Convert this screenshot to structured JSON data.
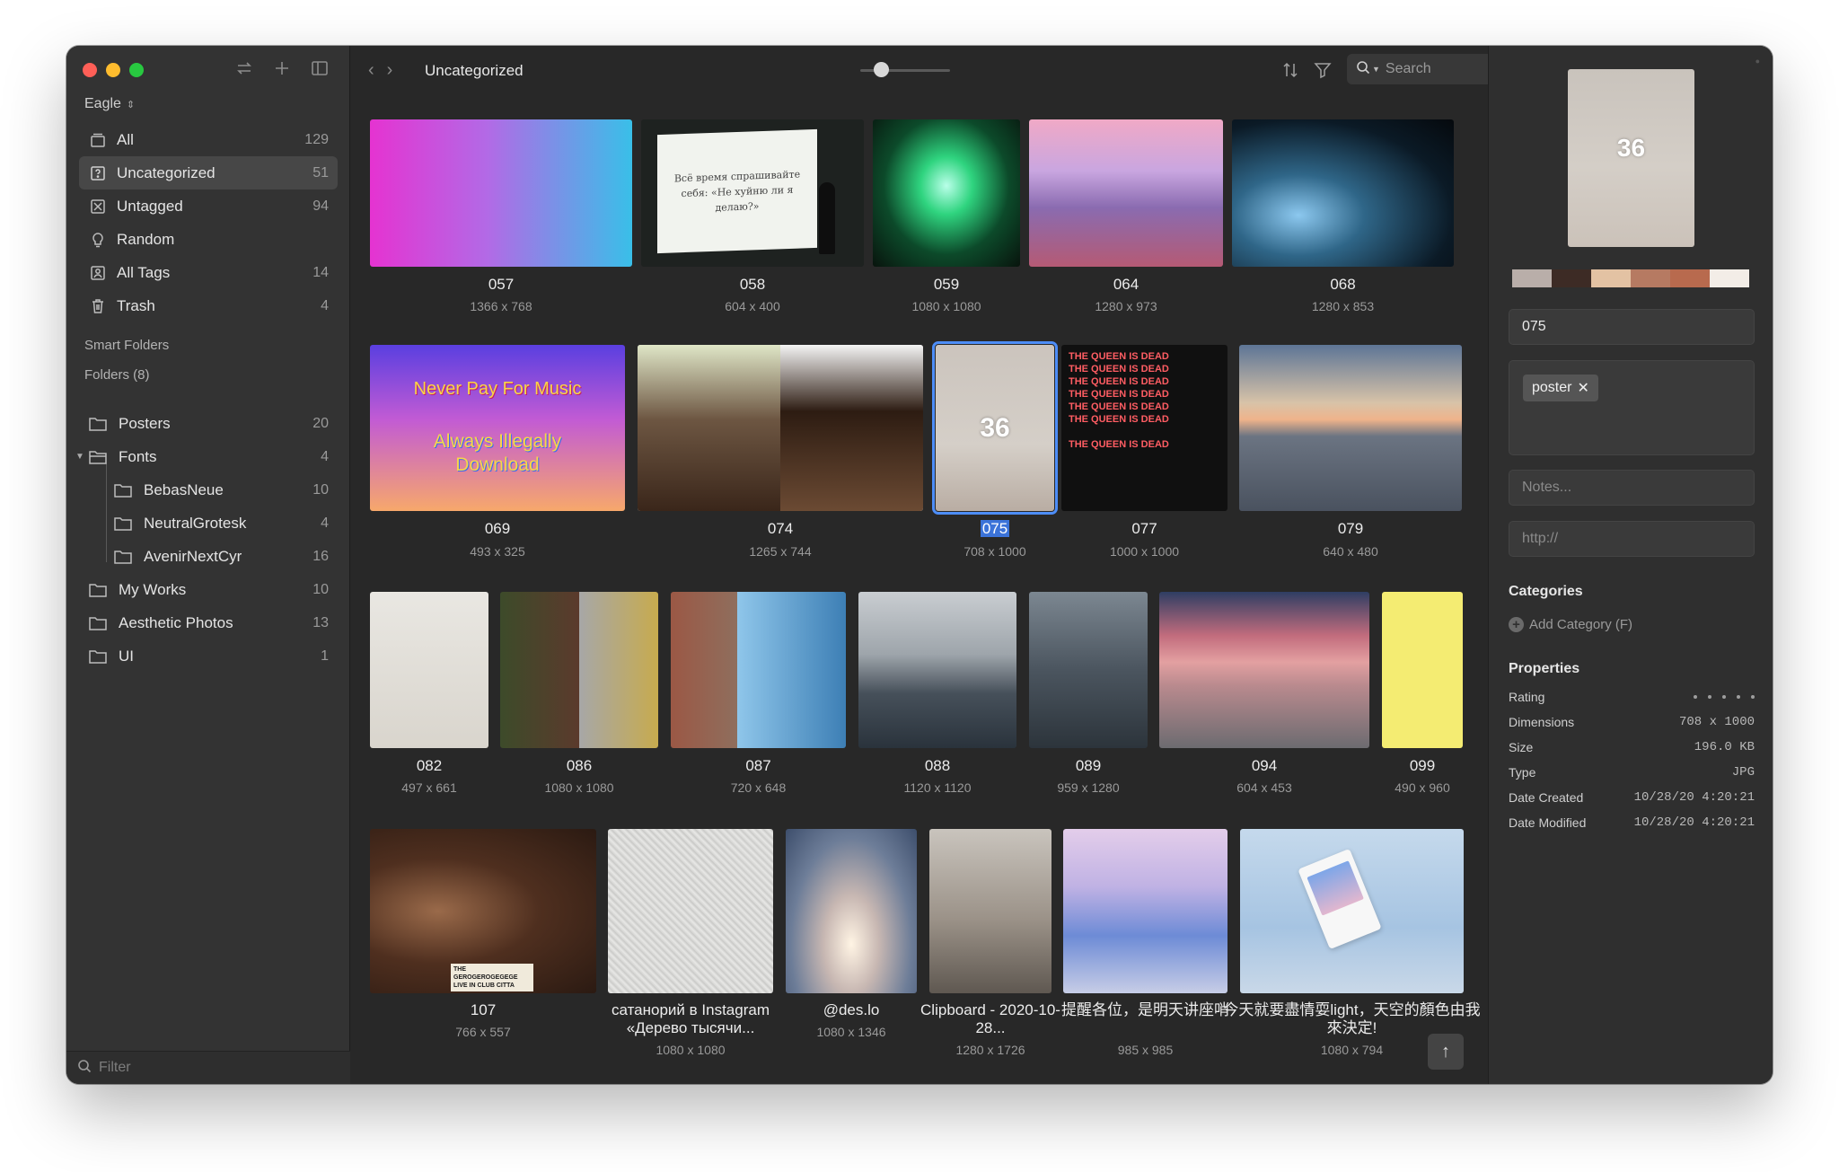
{
  "sidebar": {
    "library": "Eagle",
    "nav": [
      {
        "label": "All",
        "count": "129",
        "icon": "stack-icon"
      },
      {
        "label": "Uncategorized",
        "count": "51",
        "icon": "question-folder-icon"
      },
      {
        "label": "Untagged",
        "count": "94",
        "icon": "untagged-icon"
      },
      {
        "label": "Random",
        "count": "",
        "icon": "bulb-icon"
      },
      {
        "label": "All Tags",
        "count": "14",
        "icon": "tag-icon"
      },
      {
        "label": "Trash",
        "count": "4",
        "icon": "trash-icon"
      }
    ],
    "smart_folders_label": "Smart Folders",
    "folders_label": "Folders (8)",
    "folders": [
      {
        "label": "Posters",
        "count": "20"
      },
      {
        "label": "Fonts",
        "count": "4"
      },
      {
        "label": "BebasNeue",
        "count": "10"
      },
      {
        "label": "NeutralGrotesk",
        "count": "4"
      },
      {
        "label": "AvenirNextCyr",
        "count": "16"
      },
      {
        "label": "My Works",
        "count": "10"
      },
      {
        "label": "Aesthetic Photos",
        "count": "13"
      },
      {
        "label": "UI",
        "count": "1"
      }
    ],
    "filter_placeholder": "Filter"
  },
  "toolbar": {
    "title": "Uncategorized",
    "search_placeholder": "Search"
  },
  "grid": [
    {
      "name": "057",
      "dims": "1366 x 768"
    },
    {
      "name": "058",
      "dims": "604 x 400"
    },
    {
      "name": "059",
      "dims": "1080 x 1080"
    },
    {
      "name": "064",
      "dims": "1280 x 973"
    },
    {
      "name": "068",
      "dims": "1280 x 853"
    },
    {
      "name": "069",
      "dims": "493 x 325"
    },
    {
      "name": "074",
      "dims": "1265 x 744"
    },
    {
      "name": "075",
      "dims": "708 x 1000"
    },
    {
      "name": "077",
      "dims": "1000 x 1000"
    },
    {
      "name": "079",
      "dims": "640 x 480"
    },
    {
      "name": "082",
      "dims": "497 x 661"
    },
    {
      "name": "086",
      "dims": "1080 x 1080"
    },
    {
      "name": "087",
      "dims": "720 x 648"
    },
    {
      "name": "088",
      "dims": "1120 x 1120"
    },
    {
      "name": "089",
      "dims": "959 x 1280"
    },
    {
      "name": "094",
      "dims": "604 x 453"
    },
    {
      "name": "099",
      "dims": "490 x 960"
    },
    {
      "name": "107",
      "dims": "766 x 557"
    },
    {
      "name": "сатанорий в Instagram «Дерево тысячи...",
      "dims": "1080 x 1080"
    },
    {
      "name": "@des.lo",
      "dims": "1080 x 1346"
    },
    {
      "name": "Clipboard - 2020-10-28...",
      "dims": "1280 x 1726"
    },
    {
      "name": "提醒各位，是明天讲座哨",
      "dims": "985 x 985"
    },
    {
      "name": "今天就要盡情耍light，天空的顏色由我來決定!",
      "dims": "1080 x 794"
    }
  ],
  "image_text": {
    "slide_058": "Всё время спрашивайте себя: «Не хуйню ли я делаю?»",
    "poster_069_line1": "Never Pay For Music",
    "poster_069_line2": "Always Illegally Download",
    "poster_075": "36",
    "poster_077": "THE QUEEN IS DEAD",
    "sign_107": "THE GEROGEROGEGEGE LIVE IN CLUB CITTA"
  },
  "inspector": {
    "preview_number": "36",
    "palette": [
      "#b9aea9",
      "#3d2b25",
      "#e3c2a3",
      "#b67a62",
      "#b86a4e",
      "#f3ede7"
    ],
    "name_value": "075",
    "tag": "poster",
    "notes_placeholder": "Notes...",
    "url_placeholder": "http://",
    "categories_heading": "Categories",
    "add_category": "Add Category (F)",
    "properties_heading": "Properties",
    "rating_label": "Rating",
    "rating_value": 0,
    "rating_max": 5,
    "properties": [
      {
        "key": "Dimensions",
        "value": "708 x 1000"
      },
      {
        "key": "Size",
        "value": "196.0 KB"
      },
      {
        "key": "Type",
        "value": "JPG"
      },
      {
        "key": "Date Created",
        "value": "10/28/20 4:20:21"
      },
      {
        "key": "Date Modified",
        "value": "10/28/20 4:20:21"
      }
    ]
  }
}
